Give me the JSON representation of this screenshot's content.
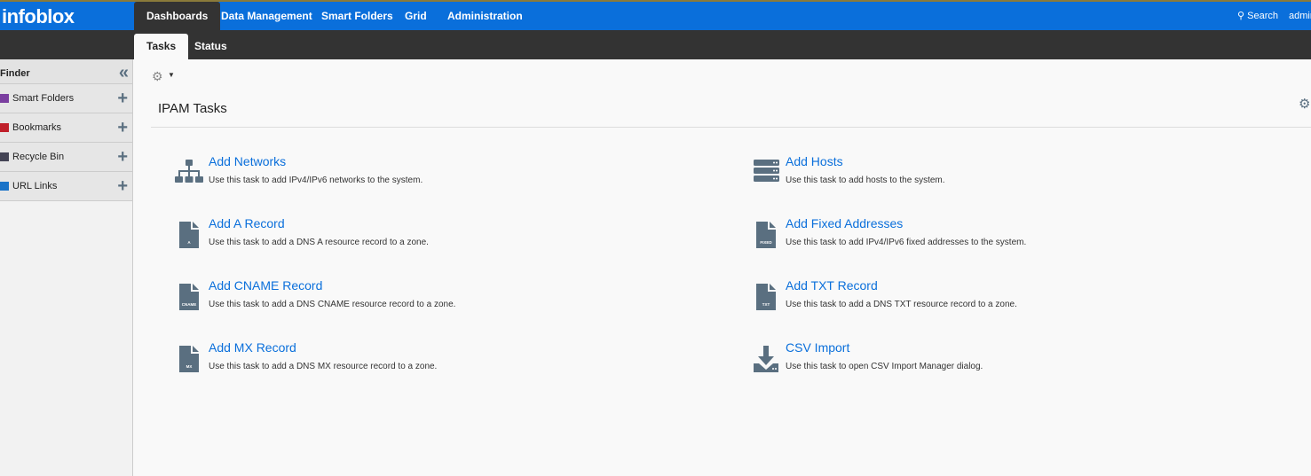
{
  "brand": "infoblox",
  "nav": [
    "Dashboards",
    "Data Management",
    "Smart Folders",
    "Grid",
    "Administration"
  ],
  "search": "Search",
  "user": "admin",
  "subtabs": [
    "Tasks",
    "Status"
  ],
  "sidebar": {
    "title": "Finder",
    "items": [
      {
        "label": "Smart Folders",
        "color": "#7b3fa0"
      },
      {
        "label": "Bookmarks",
        "color": "#c0202a"
      },
      {
        "label": "Recycle Bin",
        "color": "#445"
      },
      {
        "label": "URL Links",
        "color": "#1a73c8"
      }
    ]
  },
  "main": {
    "title": "IPAM Tasks",
    "tasks": [
      {
        "title": "Add Networks",
        "desc": "Use this task to add IPv4/IPv6 networks to the system.",
        "icon": "network-icon",
        "icon_label": ""
      },
      {
        "title": "Add Hosts",
        "desc": "Use this task to add hosts to the system.",
        "icon": "server-icon",
        "icon_label": ""
      },
      {
        "title": "Add A Record",
        "desc": "Use this task to add a DNS A resource record to a zone.",
        "icon": "file-icon",
        "icon_label": "A"
      },
      {
        "title": "Add Fixed Addresses",
        "desc": "Use this task to add IPv4/IPv6 fixed addresses to the system.",
        "icon": "file-icon",
        "icon_label": "FIXED"
      },
      {
        "title": "Add CNAME Record",
        "desc": "Use this task to add a DNS CNAME resource record to a zone.",
        "icon": "file-icon",
        "icon_label": "CNAME"
      },
      {
        "title": "Add TXT Record",
        "desc": "Use this task to add a DNS TXT resource record to a zone.",
        "icon": "file-icon",
        "icon_label": "TXT"
      },
      {
        "title": "Add MX Record",
        "desc": "Use this task to add a DNS MX resource record to a zone.",
        "icon": "file-icon",
        "icon_label": "MX"
      },
      {
        "title": "CSV Import",
        "desc": "Use this task to open CSV Import Manager dialog.",
        "icon": "download-icon",
        "icon_label": ""
      }
    ]
  },
  "colors": {
    "primary": "#0a6fdb",
    "dark": "#333333",
    "icon": "#5a6f80"
  }
}
